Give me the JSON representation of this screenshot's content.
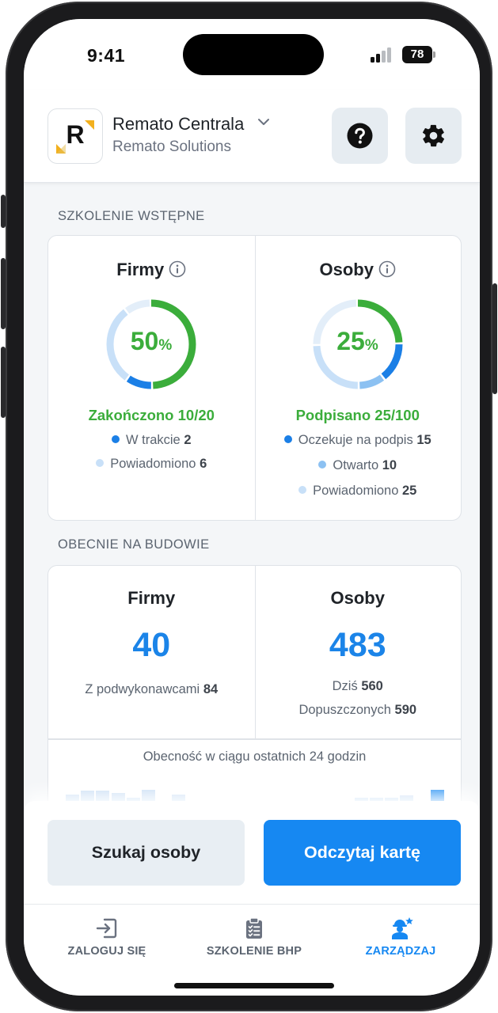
{
  "status_bar": {
    "time": "9:41",
    "battery": "78"
  },
  "header": {
    "org_name": "Remato Centrala",
    "org_sub": "Remato Solutions",
    "logo_letter": "R"
  },
  "initial_training": {
    "section_label": "SZKOLENIE WSTĘPNE",
    "companies": {
      "title": "Firmy",
      "percent": "50",
      "percent_sign": "%",
      "done_label": "Zakończono 10/20",
      "legend": [
        {
          "label": "W trakcie",
          "value": "2",
          "color": "#1b7fe6"
        },
        {
          "label": "Powiadomiono",
          "value": "6",
          "color": "#c8e0f8"
        }
      ],
      "segments": {
        "done": 0.5,
        "in_progress": 0.1,
        "notified": 0.3,
        "rest": 0.1
      }
    },
    "people": {
      "title": "Osoby",
      "percent": "25",
      "percent_sign": "%",
      "done_label": "Podpisano 25/100",
      "legend": [
        {
          "label": "Oczekuje na podpis",
          "value": "15",
          "color": "#1b7fe6"
        },
        {
          "label": "Otwarto",
          "value": "10",
          "color": "#8cc1f2"
        },
        {
          "label": "Powiadomiono",
          "value": "25",
          "color": "#c8e0f8"
        }
      ],
      "segments": {
        "done": 0.25,
        "pending": 0.15,
        "opened": 0.1,
        "notified": 0.25,
        "rest": 0.25
      }
    }
  },
  "on_site": {
    "section_label": "OBECNIE NA BUDOWIE",
    "companies": {
      "title": "Firmy",
      "value": "40",
      "sub_label": "Z podwykonawcami",
      "sub_value": "84"
    },
    "people": {
      "title": "Osoby",
      "value": "483",
      "today_label": "Dziś",
      "today_value": "560",
      "allowed_label": "Dopuszczonych",
      "allowed_value": "590"
    },
    "attendance_title": "Obecność w ciągu ostatnich 24 godzin",
    "attendance_bars": [
      0.45,
      0.6,
      0.6,
      0.5,
      0.3,
      0.65,
      0.1,
      0.45,
      0,
      0,
      0,
      0,
      0,
      0,
      0,
      0,
      0,
      0,
      0,
      0.3,
      0.3,
      0.3,
      0.4,
      0.1,
      0.65
    ],
    "highlight_last": true
  },
  "actions": {
    "search_label": "Szukaj osoby",
    "read_card_label": "Odczytaj kartę"
  },
  "tabs": [
    {
      "label": "ZALOGUJ SIĘ",
      "icon": "login-icon",
      "active": false
    },
    {
      "label": "SZKOLENIE BHP",
      "icon": "clipboard-checklist-icon",
      "active": false
    },
    {
      "label": "ZARZĄDZAJ",
      "icon": "worker-star-icon",
      "active": true
    }
  ],
  "colors": {
    "accent": "#1688f2",
    "success": "#3bad3b"
  }
}
